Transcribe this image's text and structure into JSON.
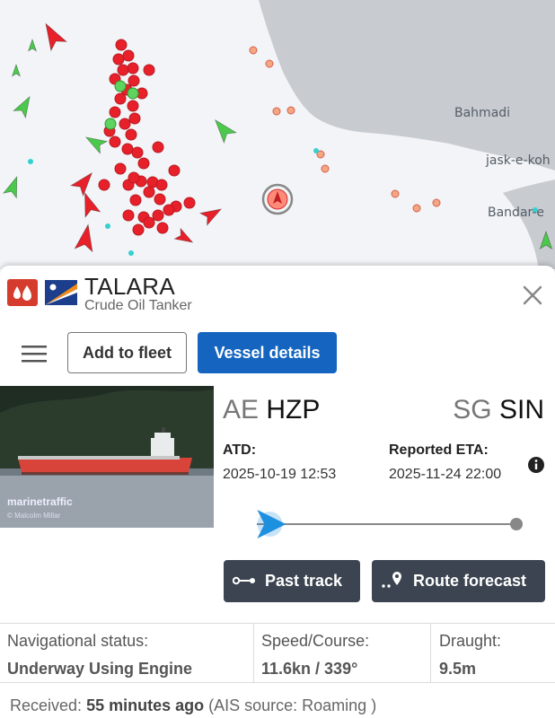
{
  "map": {
    "labels": [
      "Bahmadi",
      "jask-e-koh",
      "Bandar-e"
    ],
    "colors": {
      "water": "#f2f4f7",
      "land": "#c8ccd1",
      "cargo": "#e8202a",
      "tanker_green": "#4cc94c",
      "selected": "#e03030"
    }
  },
  "vessel": {
    "type_icon": "tanker-drop-icon",
    "flag_icon": "marshall-islands-flag-icon",
    "name": "TALARA",
    "type": "Crude Oil Tanker"
  },
  "actions": {
    "menu_icon": "hamburger-menu-icon",
    "add_to_fleet": "Add to fleet",
    "vessel_details": "Vessel details",
    "close_icon": "close-icon"
  },
  "photo": {
    "watermark": "marinetraffic",
    "credit": "© Malcolm Millar"
  },
  "voyage": {
    "from_country": "AE",
    "from_port": "HZP",
    "to_country": "SG",
    "to_port": "SIN",
    "atd_label": "ATD:",
    "atd_value": "2025-10-19 12:53",
    "eta_label": "Reported ETA:",
    "eta_value": "2025-11-24 22:00",
    "info_icon": "info-icon",
    "progress_fraction": 0.05
  },
  "buttons": {
    "past_track": "Past track",
    "route_forecast": "Route forecast"
  },
  "stats": [
    {
      "label": "Navigational status:",
      "value": "Underway Using Engine"
    },
    {
      "label": "Speed/Course:",
      "value": "11.6kn / 339°"
    },
    {
      "label": "Draught:",
      "value": "9.5m"
    }
  ],
  "received": {
    "prefix": "Received:",
    "time": "55 minutes ago",
    "source": "(AIS source: Roaming )"
  },
  "colors": {
    "primary": "#1565c0",
    "dark_button": "#3b4450",
    "tanker_red": "#d63c2d",
    "progress_blue": "#1e90e0"
  }
}
